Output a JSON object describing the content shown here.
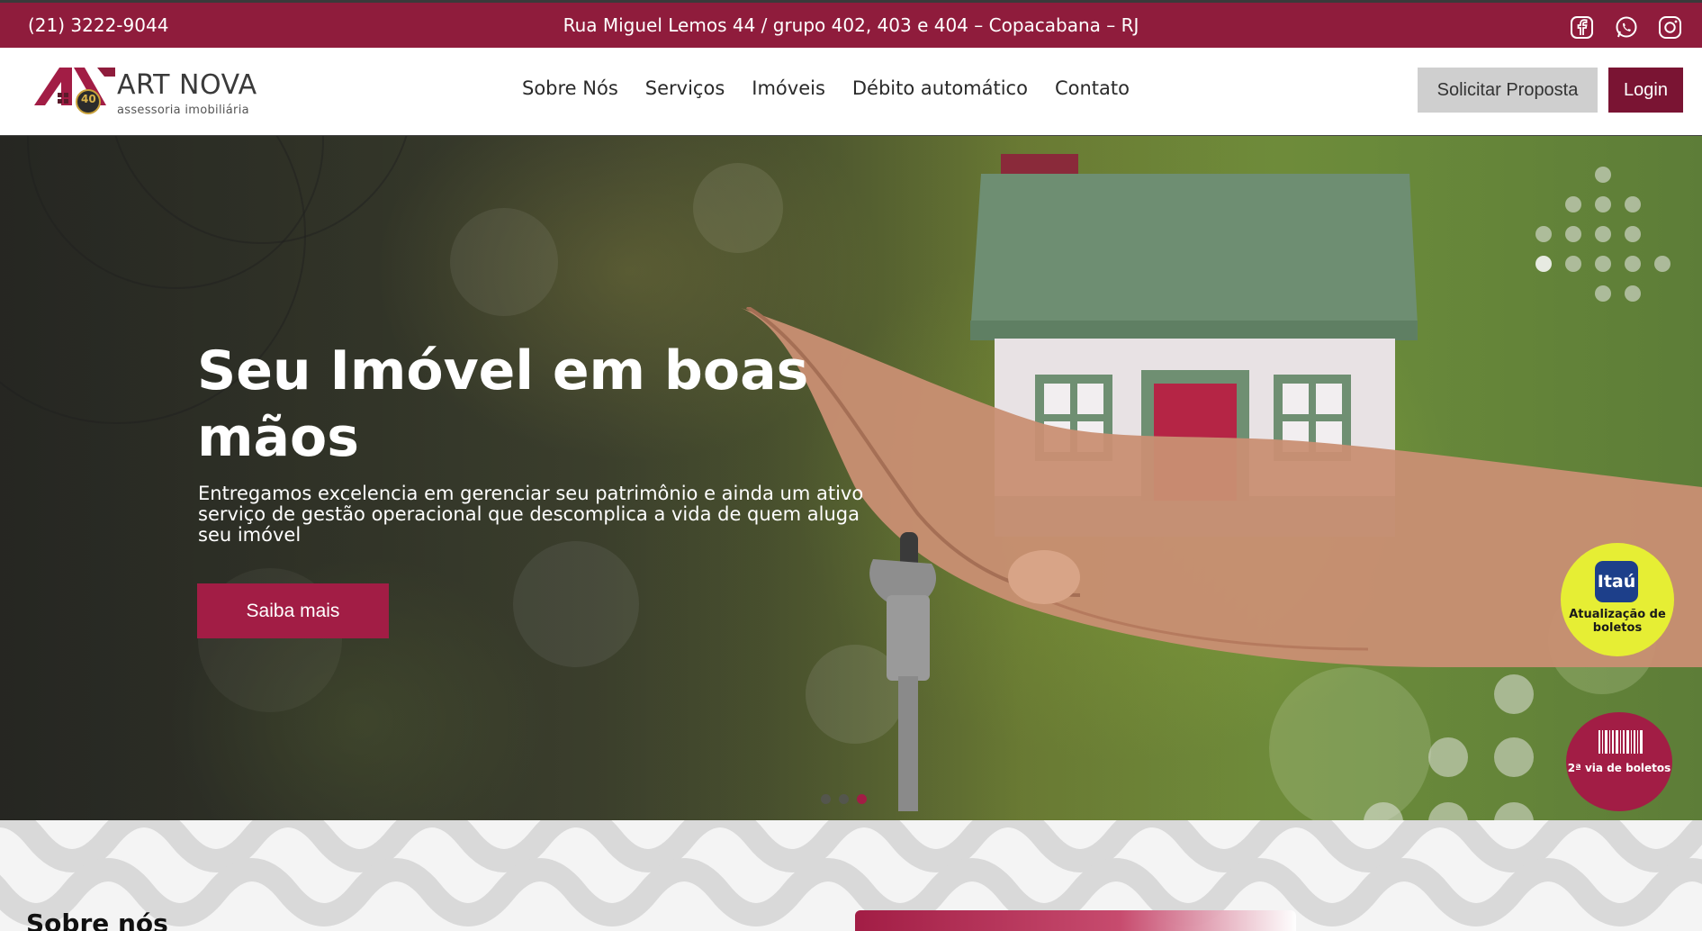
{
  "topbar": {
    "phone": "(21) 3222-9044",
    "address": "Rua Miguel Lemos 44 / grupo 402, 403 e 404 – Copacabana – RJ",
    "social": [
      "facebook-icon",
      "whatsapp-icon",
      "instagram-icon"
    ]
  },
  "header": {
    "logo_brand": "ART NOVA",
    "logo_sub": "assessoria imobiliária",
    "logo_badge": "40",
    "nav": [
      "Sobre Nós",
      "Serviços",
      "Imóveis",
      "Débito automático",
      "Contato"
    ],
    "proposal_label": "Solicitar Proposta",
    "login_label": "Login"
  },
  "hero": {
    "title": "Seu Imóvel em boas mãos",
    "description": "Entregamos excelencia em gerenciar seu patrimônio e ainda um ativo serviço de gestão operacional que descomplica a vida de quem aluga seu imóvel",
    "cta_label": "Saiba mais",
    "slides_count": 3,
    "active_slide": 3
  },
  "floating": {
    "itau_logo": "Itaú",
    "itau_label": "Atualização de boletos",
    "boleto_label": "2ª via de boletos"
  },
  "about": {
    "title": "Sobre nós"
  },
  "colors": {
    "brand": "#8f1c3c",
    "accent": "#a21d45",
    "login": "#7a1433",
    "itau_yellow": "#e6ee34",
    "itau_blue": "#1d3f8a"
  }
}
